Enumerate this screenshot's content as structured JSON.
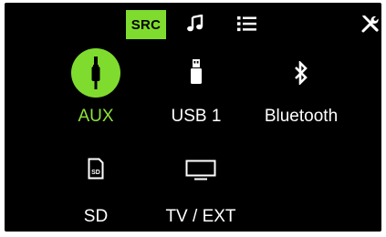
{
  "header": {
    "tabs": [
      {
        "id": "src",
        "label": "SRC",
        "active": true
      },
      {
        "id": "music",
        "icon": "music-note-icon"
      },
      {
        "id": "list",
        "icon": "list-icon"
      }
    ],
    "settings_icon": "tools-icon"
  },
  "sources": [
    {
      "label": "AUX",
      "icon": "aux-jack-icon",
      "active": true
    },
    {
      "label": "USB 1",
      "icon": "usb-icon",
      "active": false
    },
    {
      "label": "Bluetooth",
      "icon": "bluetooth-icon",
      "active": false
    },
    {
      "label": "SD",
      "icon": "sd-card-icon",
      "active": false
    },
    {
      "label": "TV / EXT",
      "icon": "tv-icon",
      "active": false
    }
  ],
  "colors": {
    "accent": "#7fdc2f",
    "active_text": "#8ee23a",
    "background": "#000000",
    "text": "#ffffff"
  }
}
